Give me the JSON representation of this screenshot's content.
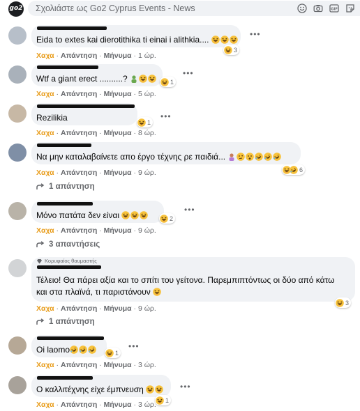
{
  "composer": {
    "placeholder": "Σχολιάστε ως Go2 Cyprus Events - News",
    "icons": [
      "emoji-icon",
      "camera-icon",
      "gif-icon",
      "sticker-icon"
    ],
    "logo_text": "go2"
  },
  "labels": {
    "haha": "Χαχα",
    "reply": "Απάντηση",
    "message": "Μήνυμα",
    "sep": "·"
  },
  "comments": [
    {
      "text": "Eida to extes kai dierotithika ti einai i alithkia....",
      "time": "1 ώρ.",
      "reaction_count": "3"
    },
    {
      "text": "Wtf a giant erect ..........?",
      "time": "5 ώρ.",
      "reaction_count": "1"
    },
    {
      "text": "Rezilikia",
      "time": "8 ώρ.",
      "reaction_count": "1"
    },
    {
      "text": "Να μην καταλαβαίνετε απο έργο τέχνης ρε παιδιά...",
      "time": "9 ώρ.",
      "reaction_count": "6",
      "replies": "1 απάντηση"
    },
    {
      "text": "Μόνο πατάτα δεν είναι",
      "time": "9 ώρ.",
      "reaction_count": "2",
      "replies": "3 απαντήσεις"
    },
    {
      "badge": "Κορυφαίος θαυμαστής",
      "text_line1": "Τέλειο! Θα πάρει αξία και το σπίτι του γείτονα. Παρεμπιπτόντως οι δύο από κάτω",
      "text_line2": "και στα πλαϊνά, τι παριστάνουν",
      "time": "9 ώρ.",
      "reaction_count": "3",
      "replies": "1 απάντηση"
    },
    {
      "text": "Oi laomo",
      "time": "3 ώρ.",
      "reaction_count": "1"
    },
    {
      "text": "Ο καλλιτέχνης είχε έμπνευση",
      "time": "3 ώρ.",
      "reaction_count": "1"
    }
  ],
  "colors": {
    "haha_accent": "#e89c1a",
    "bubble": "#f0f2f5",
    "meta": "#65676b"
  }
}
